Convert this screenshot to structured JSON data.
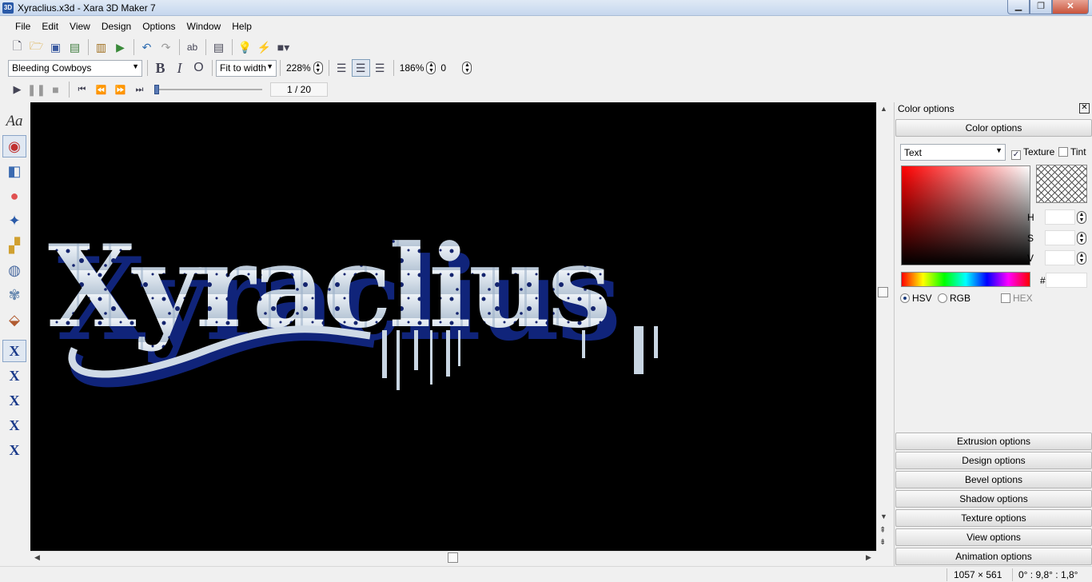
{
  "window": {
    "app_icon": "3D",
    "title": "Xyraclius.x3d - Xara 3D Maker 7",
    "controls": [
      "minimize",
      "maximize",
      "close"
    ]
  },
  "menu": [
    "File",
    "Edit",
    "View",
    "Design",
    "Options",
    "Window",
    "Help"
  ],
  "toolbar1": {
    "icons": [
      "new-document-icon",
      "open-folder-icon",
      "save-icon",
      "export-icon",
      "import-design-icon",
      "import-icon",
      "undo-icon",
      "redo-icon",
      "spell-check-icon",
      "animation-icon",
      "light-bulb-icon",
      "lightning-icon",
      "frame-icon"
    ]
  },
  "toolbar2": {
    "font": "Bleeding Cowboys",
    "bold": "B",
    "italic": "I",
    "outline": "O",
    "fit_mode": "Fit to width",
    "zoom": "228%",
    "align": [
      "left",
      "center",
      "right"
    ],
    "align_active": "center",
    "size": "186%",
    "spacing": "0"
  },
  "toolbar3": {
    "frame": "1 / 20",
    "slider_position": 0.0,
    "buttons": [
      "play",
      "pause",
      "stop",
      "first-frame",
      "previous-frame",
      "next-frame",
      "last-frame"
    ]
  },
  "left_tools": [
    {
      "name": "text-tool",
      "glyph": "Aa",
      "active": false
    },
    {
      "name": "color-tool",
      "glyph": "◉",
      "active": true
    },
    {
      "name": "extrusion-tool",
      "glyph": "◧",
      "active": false
    },
    {
      "name": "bevel-tool",
      "glyph": "●",
      "active": false
    },
    {
      "name": "lighting-tool",
      "glyph": "✦",
      "active": false
    },
    {
      "name": "shadow-tool",
      "glyph": "▞",
      "active": false
    },
    {
      "name": "texture-tool",
      "glyph": "◍",
      "active": false
    },
    {
      "name": "design-tool",
      "glyph": "✾",
      "active": false
    },
    {
      "name": "background-tool",
      "glyph": "⬙",
      "active": false
    },
    {
      "name": "animation-x-tool-1",
      "glyph": "X",
      "active": true
    },
    {
      "name": "animation-x-tool-2",
      "glyph": "X",
      "active": false
    },
    {
      "name": "animation-x-tool-3",
      "glyph": "X",
      "active": false
    },
    {
      "name": "animation-x-tool-4",
      "glyph": "X",
      "active": false
    },
    {
      "name": "animation-x-tool-5",
      "glyph": "X",
      "active": false
    }
  ],
  "canvas": {
    "text": "Xyraclius",
    "background": "#000000",
    "face_color": "#d8e2ec",
    "extrusion_color": "#10247a"
  },
  "panel": {
    "header": "Color options",
    "color_options_button": "Color options",
    "target": "Text",
    "texture_label": "Texture",
    "texture_checked": true,
    "tint_label": "Tint",
    "tint_checked": false,
    "fields": {
      "h": "H",
      "s": "S",
      "v": "V",
      "hash": "#"
    },
    "modes": {
      "hsv": "HSV",
      "rgb": "RGB",
      "hex": "HEX"
    },
    "mode_selected": "HSV",
    "sections": [
      "Extrusion options",
      "Design options",
      "Bevel options",
      "Shadow options",
      "Texture options",
      "View options",
      "Animation options"
    ]
  },
  "status": {
    "size": "1057 × 561",
    "angle": "0° : 9,8° : 1,8°"
  }
}
